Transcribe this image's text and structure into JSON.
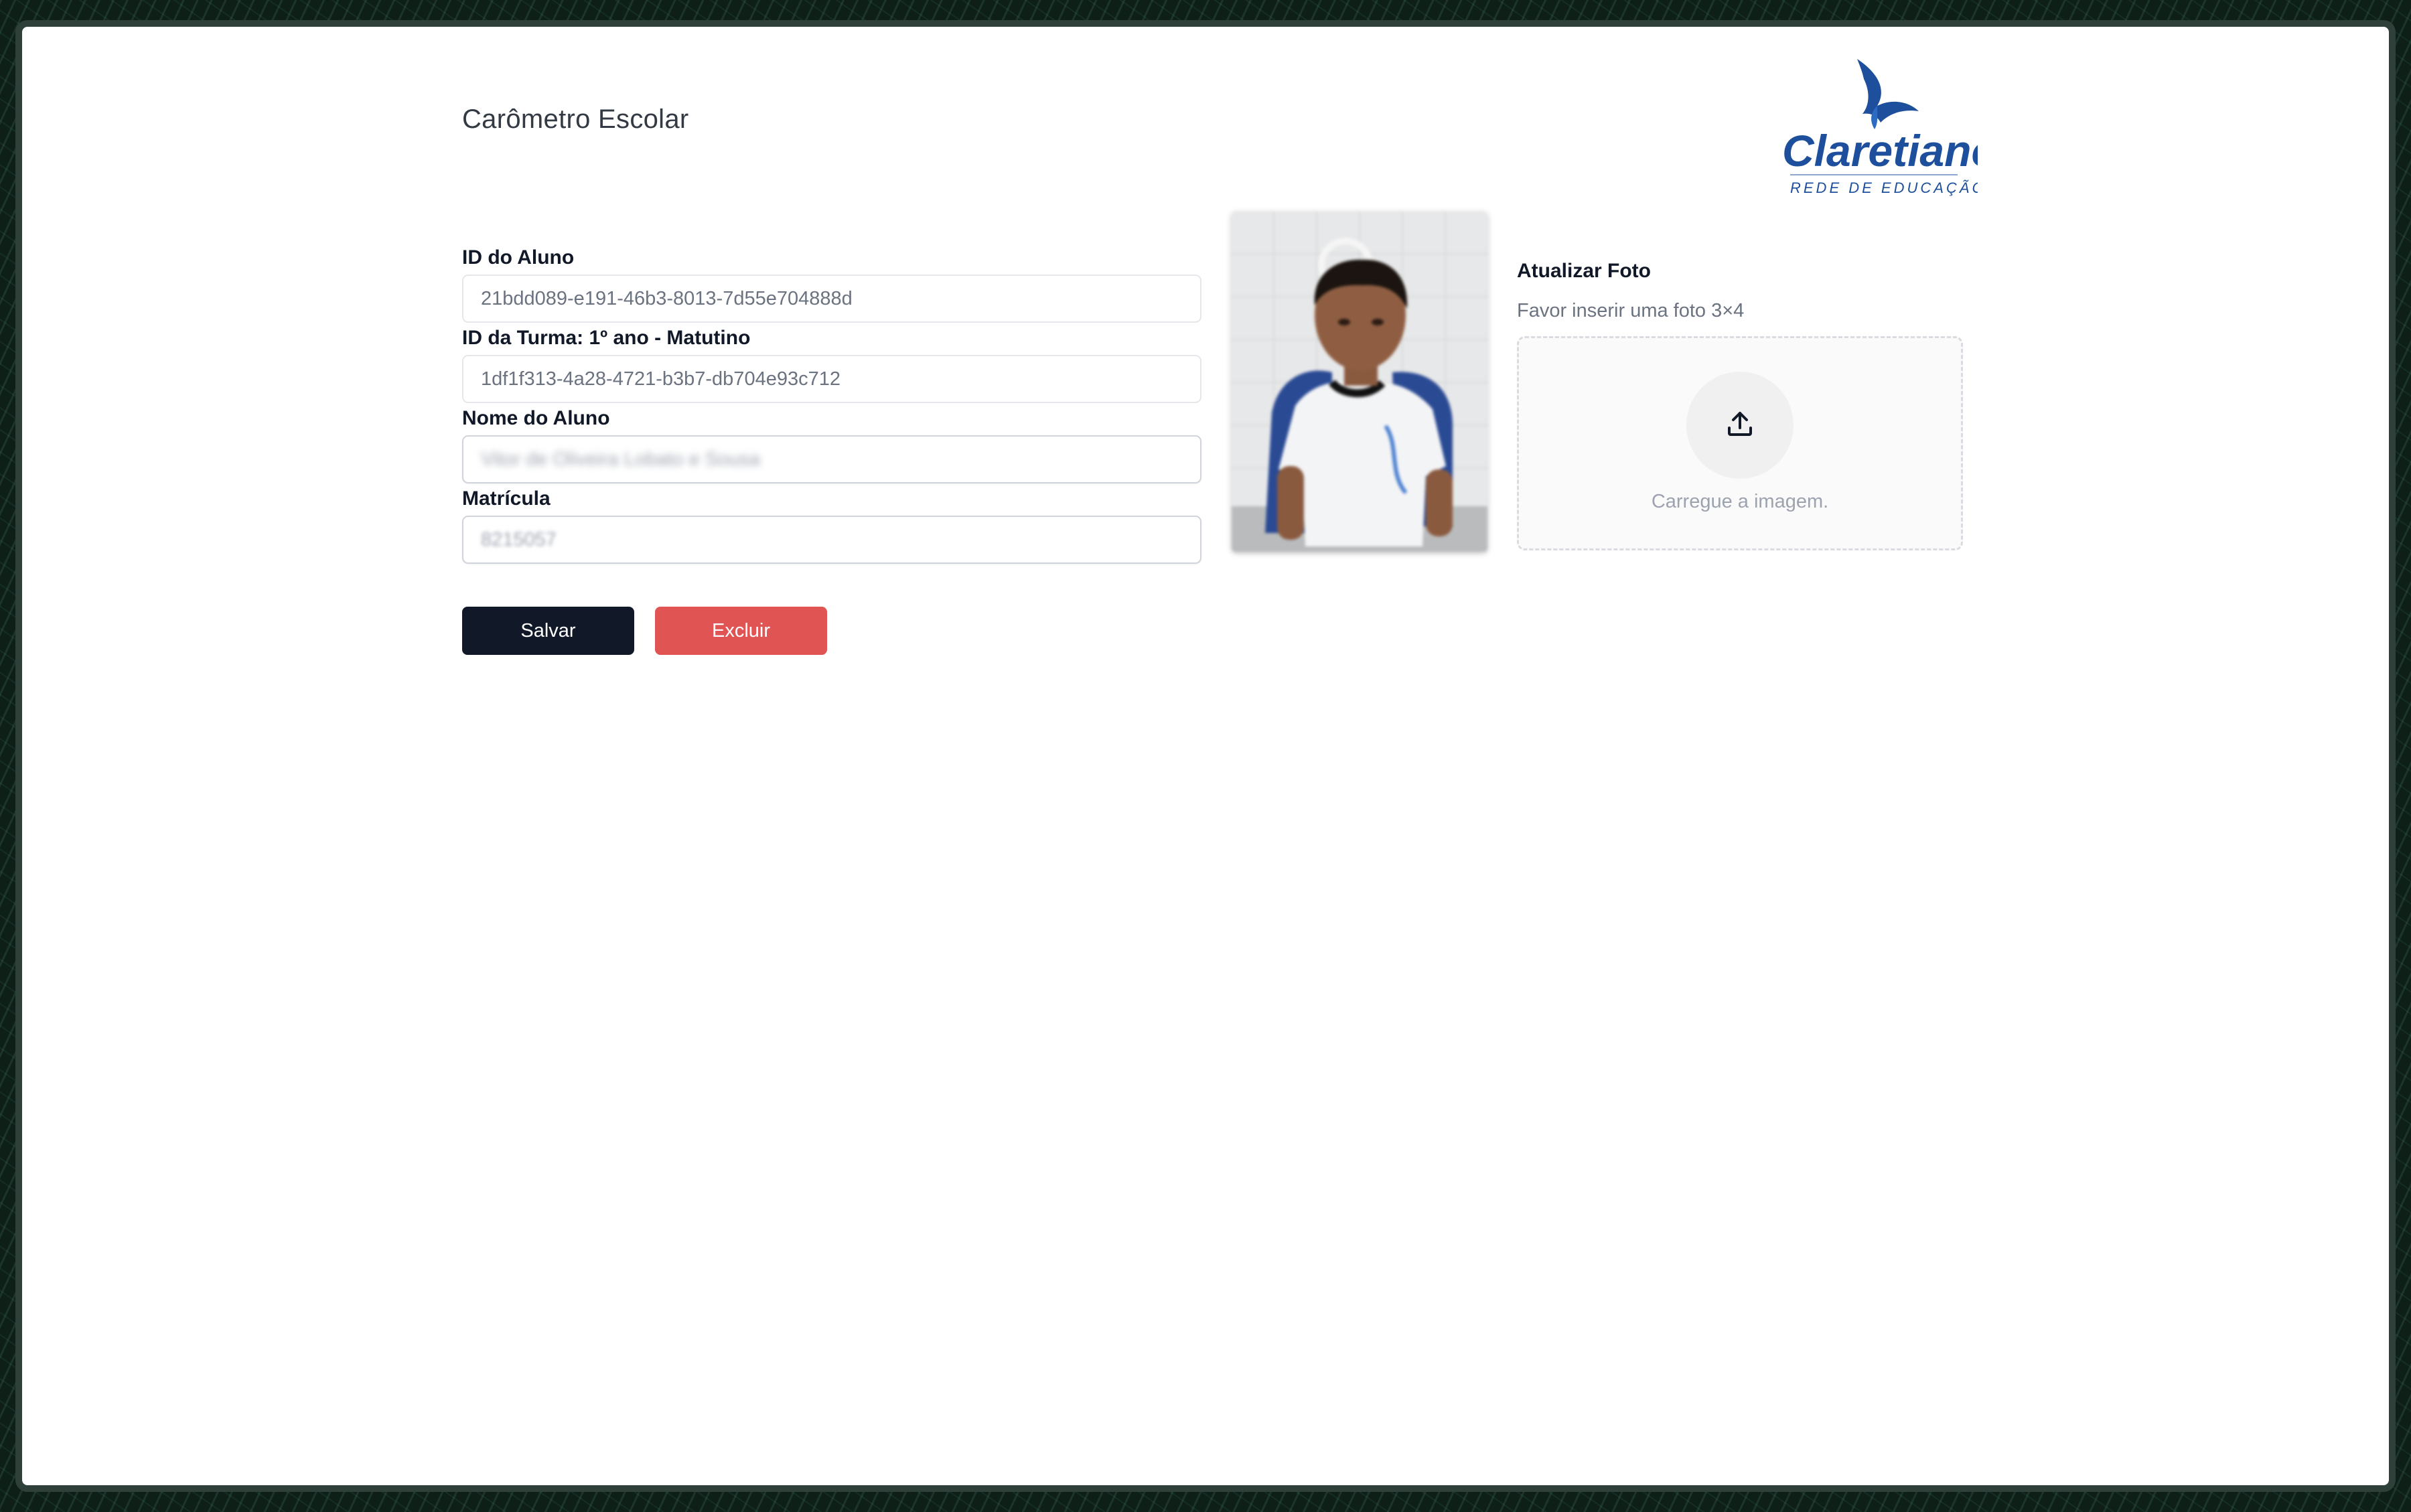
{
  "header": {
    "title": "Carômetro Escolar",
    "logo": {
      "name": "Claretiano",
      "tagline": "REDE DE EDUCAÇÃO",
      "color": "#1d4f9c"
    }
  },
  "form": {
    "student_id": {
      "label": "ID do Aluno",
      "value": "21bdd089-e191-46b3-8013-7d55e704888d"
    },
    "class_id": {
      "label": "ID da Turma: 1º ano - Matutino",
      "value": "1df1f313-4a28-4721-b3b7-db704e93c712"
    },
    "student_name": {
      "label": "Nome do Aluno",
      "value": "Vitor de Oliveira Lobato e Sousa"
    },
    "registration": {
      "label": "Matrícula",
      "value": "8215057"
    }
  },
  "buttons": {
    "save_label": "Salvar",
    "delete_label": "Excluir",
    "save_color": "#111827",
    "delete_color": "#e05454"
  },
  "photo_upload": {
    "title": "Atualizar Foto",
    "hint": "Favor inserir uma foto 3×4",
    "dropzone_text": "Carregue a imagem.",
    "icon": "upload-icon"
  }
}
